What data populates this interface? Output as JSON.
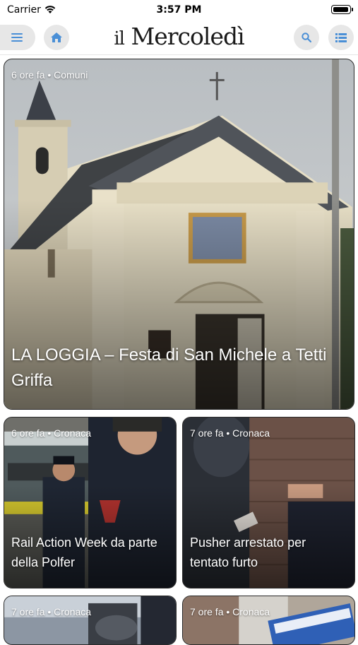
{
  "status": {
    "carrier": "Carrier",
    "time": "3:57 PM"
  },
  "header": {
    "logo_il": "il",
    "logo_main": "Mercoledì"
  },
  "articles": [
    {
      "meta": "6 ore fa • Comuni",
      "title": "LA LOGGIA – Festa di San Michele a Tetti Griffa"
    },
    {
      "meta": "6 ore fa • Cronaca",
      "title": "Rail Action Week da parte della Polfer"
    },
    {
      "meta": "7 ore fa • Cronaca",
      "title": "Pusher arrestato per tentato furto"
    },
    {
      "meta": "7 ore fa • Cronaca",
      "title": ""
    },
    {
      "meta": "7 ore fa • Cronaca",
      "title": ""
    }
  ],
  "icons": {
    "menu": "menu-icon",
    "home": "home-icon",
    "search": "search-icon",
    "list": "list-icon",
    "accent": "#4a8fd6"
  }
}
